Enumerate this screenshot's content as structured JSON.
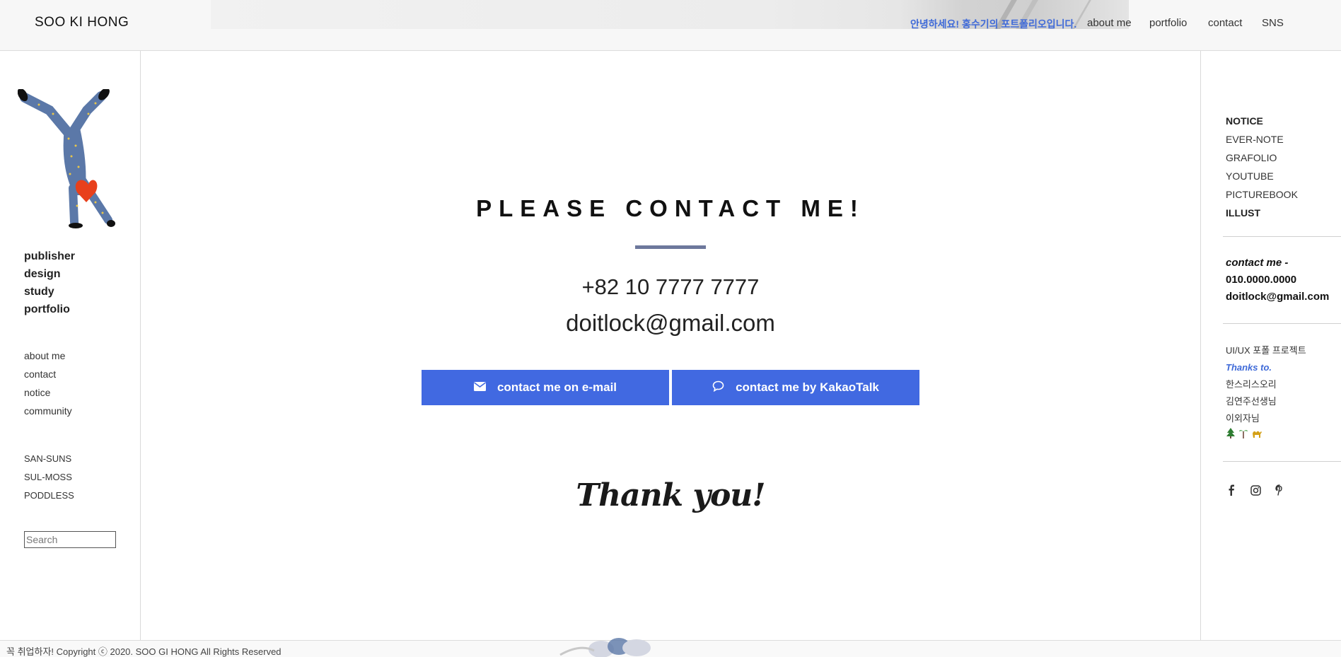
{
  "header": {
    "logo": "SOO KI HONG",
    "greeting": "안녕하세요! 홍수기의 포트폴리오입니다.",
    "nav": [
      "about me",
      "portfolio",
      "contact",
      "SNS"
    ]
  },
  "sidebar_left": {
    "categories": [
      "publisher",
      "design",
      "study",
      "portfolio"
    ],
    "menu": [
      "about me",
      "contact",
      "notice",
      "community"
    ],
    "projects": [
      "SAN-SUNS",
      "SUL-MOSS",
      "PODDLESS"
    ],
    "search_placeholder": "Search"
  },
  "main": {
    "title": "PLEASE CONTACT ME!",
    "phone": "+82 10 7777 7777",
    "email": "doitlock@gmail.com",
    "btn_email": "contact me on e-mail",
    "btn_kakao": "contact me by KakaoTalk",
    "thanks": "Thank you!"
  },
  "sidebar_right": {
    "links": [
      "NOTICE",
      "EVER-NOTE",
      "GRAFOLIO",
      "YOUTUBE",
      "PICTUREBOOK",
      "ILLUST"
    ],
    "bold_links": [
      "NOTICE",
      "ILLUST"
    ],
    "contact_label": "contact me -",
    "contact_phone": "010.0000.0000",
    "contact_email": "doitlock@gmail.com",
    "credits_title": "UI/UX 포폴 프로젝트",
    "credits_thanks": "Thanks to.",
    "credits_names": [
      "한스리스오리",
      "김연주선생님",
      "이외자님"
    ],
    "emoji_icons": [
      "tree-icon",
      "palm-icon",
      "camel-icon"
    ],
    "social_icons": [
      "facebook-icon",
      "instagram-icon",
      "pinterest-icon"
    ]
  },
  "footer": {
    "copyright": "꼭 취업하자! Copyright ⓒ 2020. SOO GI HONG All Rights Reserved"
  },
  "colors": {
    "accent": "#4169e1",
    "greeting": "#3f6ad8",
    "title_bar": "#6d789c"
  }
}
